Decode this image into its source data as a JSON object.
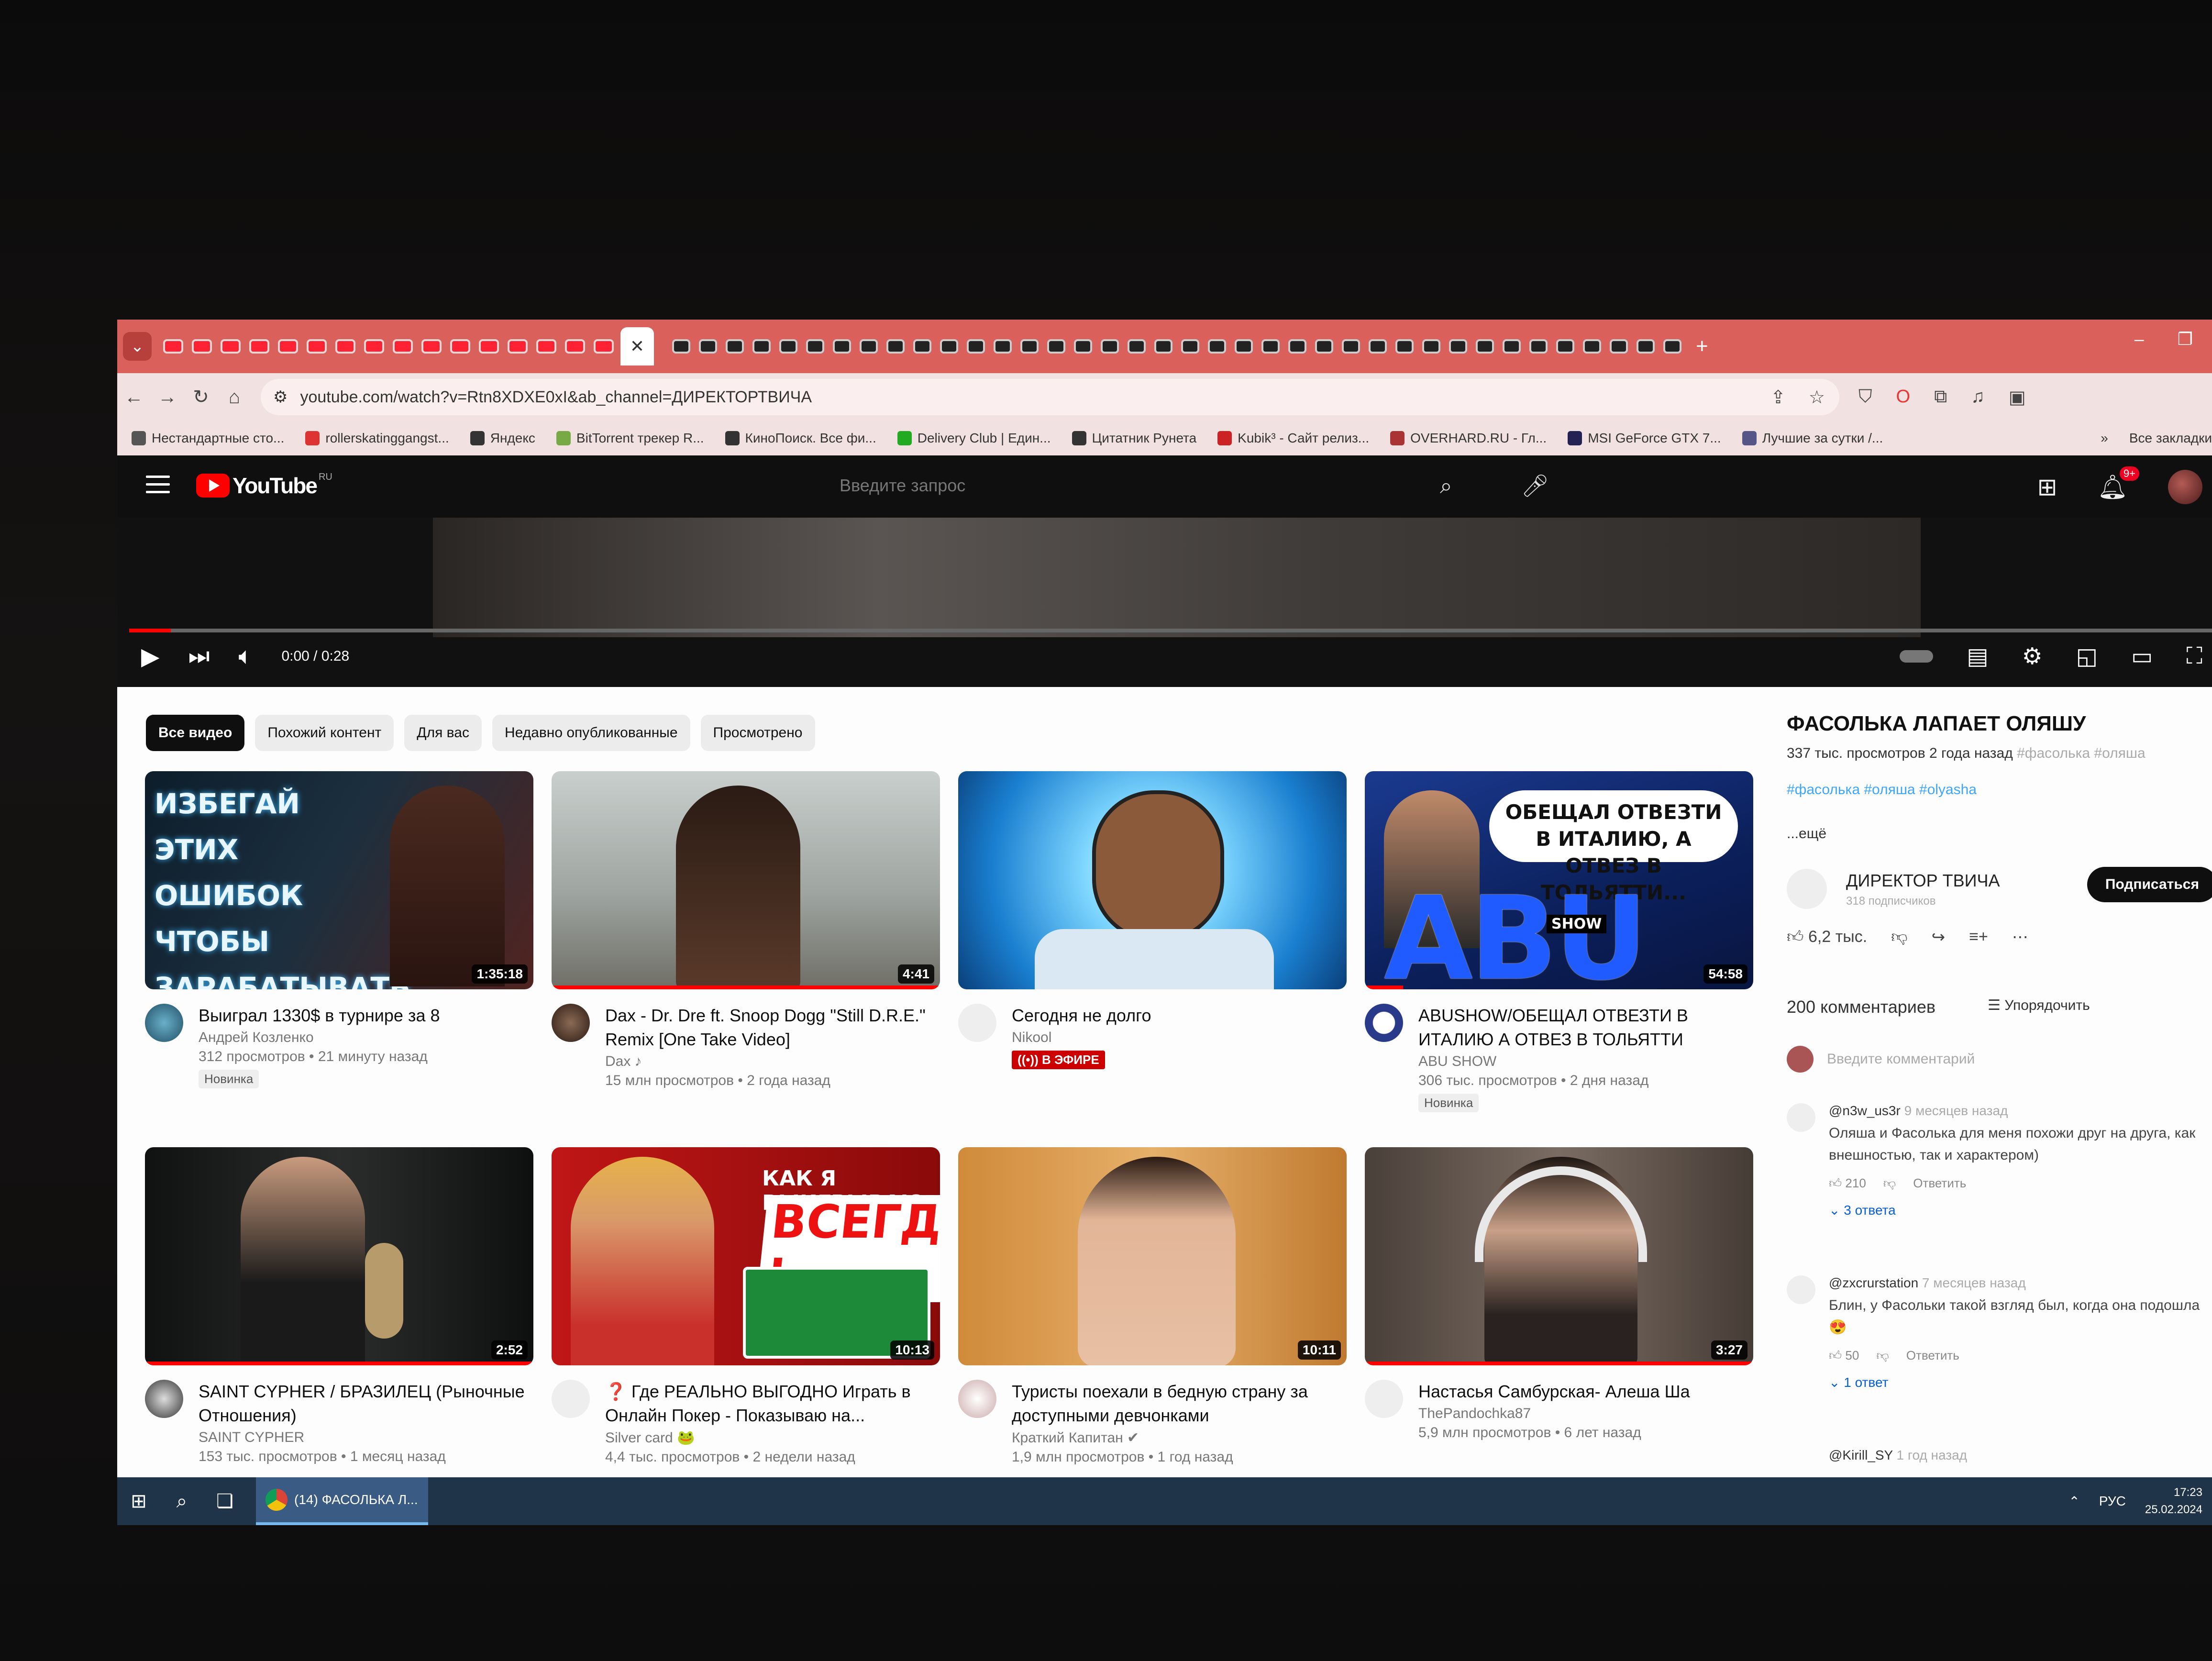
{
  "browser": {
    "url": "youtube.com/watch?v=Rtn8XDXE0xI&ab_channel=ДИРЕКТОРТВИЧА",
    "bookmarks": [
      "Нестандартные сто...",
      "rollerskatinggangst...",
      "Яндекс",
      "BitTorrent трекер R...",
      "КиноПоиск. Все фи...",
      "Delivery Club | Един...",
      "Цитатник Рунета",
      "Kubik³ - Сайт релиз...",
      "OVERHARD.RU - Гл...",
      "MSI GeForce GTX 7...",
      "Лучшие за сутки /..."
    ],
    "bookmarks_more": "Все закладки"
  },
  "header": {
    "logo": "YouTube",
    "logo_region": "RU",
    "search_placeholder": "Введите запрос",
    "notif_badge": "9+"
  },
  "player": {
    "timecode": "0:00 / 0:28",
    "progress": 0.02
  },
  "chips": [
    "Все видео",
    "Похожий контент",
    "Для вас",
    "Недавно опубликованные",
    "Просмотрено"
  ],
  "videos": [
    {
      "title": "Выиграл 1330$ в турнире за 8",
      "channel": "Андрей Козленко",
      "stats": "312 просмотров • 21 минуту назад",
      "badge": "Новинка",
      "duration": "1:35:18",
      "thumb_text": "ИЗБЕГАЙ ЭТИХ ОШИБОК ЧТОБЫ ЗАРАБАТЫВАТЬ ПОКЕРОМ"
    },
    {
      "title": "Dax - Dr. Dre ft. Snoop Dogg \"Still D.R.E.\" Remix [One Take Video]",
      "channel": "Dax ♪",
      "stats": "15 млн просмотров • 2 года назад",
      "duration": "4:41"
    },
    {
      "title": "Сегодня не долго",
      "channel": "Nikool",
      "live": "((•)) В ЭФИРЕ"
    },
    {
      "title": "ABUSHOW/ОБЕЩАЛ ОТВЕЗТИ В ИТАЛИЮ А ОТВЕЗ В ТОЛЬЯТТИ",
      "channel": "ABU SHOW",
      "stats": "306 тыс. просмотров • 2 дня назад",
      "badge": "Новинка",
      "duration": "54:58",
      "thumb_text": "ОБЕЩАЛ ОТВЕЗТИ В ИТАЛИЮ, А ОТВЕЗ В ТОЛЬЯТТИ...",
      "thumb_logo": "ABU",
      "thumb_logo_sub": "SHOW"
    },
    {
      "title": "SAINT CYPHER / БРАЗИЛЕЦ (Рыночные Отношения)",
      "channel": "SAINT CYPHER",
      "stats": "153 тыс. просмотров • 1 месяц назад",
      "duration": "2:52"
    },
    {
      "title": "❓ Где РЕАЛЬНО ВЫГОДНО Играть в Онлайн Покер - Показываю на...",
      "channel": "Silver card 🐸",
      "stats": "4,4 тыс. просмотров • 2 недели назад",
      "duration": "10:13",
      "thumb_text": "КАК Я ВЫИГРЫВАЮ",
      "thumb_text2": "ВСЕГДА !"
    },
    {
      "title": "Туристы поехали в бедную страну за доступными девчонками",
      "channel": "Краткий Капитан ✔",
      "stats": "1,9 млн просмотров • 1 год назад",
      "duration": "10:11"
    },
    {
      "title": "Настасья Самбурская- Алеша Ша",
      "channel": "ThePandochka87",
      "stats": "5,9 млн просмотров • 6 лет назад",
      "duration": "3:27"
    }
  ],
  "panel": {
    "title": "ФАСОЛЬКА ЛАПАЕТ ОЛЯШУ",
    "stats": "337 тыс. просмотров  2 года назад",
    "stats_tags": "#фасолька #оляша",
    "tags": "#фасолька #оляша #olyasha",
    "more": "...ещё",
    "channel": "ДИРЕКТОР ТВИЧА",
    "subs": "318 подписчиков",
    "subscribe": "Подписаться",
    "likes": "6,2 тыс.",
    "comments_count": "200 комментариев",
    "sort": "Упорядочить",
    "add_comment": "Введите комментарий",
    "comments": [
      {
        "author": "@n3w_us3r",
        "time": "9 месяцев назад",
        "text": "Оляша и Фасолька для меня похожи друг на друга, как внешностью, так и характером)",
        "likes": "210",
        "reply": "Ответить",
        "replies": "3 ответа"
      },
      {
        "author": "@zxcrurstation",
        "time": "7 месяцев назад",
        "text": "Блин, у  Фасольки такой взгляд был, когда она подошла 😍",
        "likes": "50",
        "reply": "Ответить",
        "replies": "1 ответ"
      },
      {
        "author": "@Kirill_SY",
        "time": "1 год назад"
      }
    ]
  },
  "taskbar": {
    "app": "(14) ФАСОЛЬКА Л...",
    "lang": "РУС",
    "time": "17:23",
    "date": "25.02.2024"
  }
}
